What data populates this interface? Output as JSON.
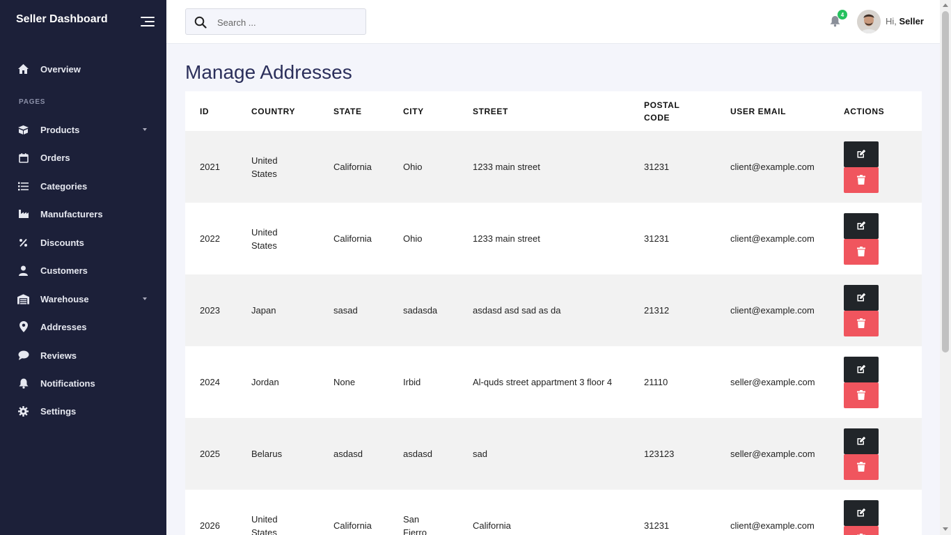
{
  "sidebar": {
    "brand": "Seller Dashboard",
    "section_label": "PAGES",
    "items": [
      {
        "label": "Overview",
        "icon": "home-icon"
      },
      {
        "label": "Products",
        "icon": "box-icon",
        "has_dropdown": true
      },
      {
        "label": "Orders",
        "icon": "calendar-icon"
      },
      {
        "label": "Categories",
        "icon": "list-icon"
      },
      {
        "label": "Manufacturers",
        "icon": "industry-icon"
      },
      {
        "label": "Discounts",
        "icon": "percent-icon"
      },
      {
        "label": "Customers",
        "icon": "user-icon"
      },
      {
        "label": "Warehouse",
        "icon": "warehouse-icon",
        "has_dropdown": true
      },
      {
        "label": "Addresses",
        "icon": "map-pin-icon"
      },
      {
        "label": "Reviews",
        "icon": "comment-icon"
      },
      {
        "label": "Notifications",
        "icon": "bell-icon"
      },
      {
        "label": "Settings",
        "icon": "gear-icon"
      }
    ]
  },
  "topbar": {
    "search_placeholder": "Search ...",
    "notification_count": "4",
    "greeting_prefix": "Hi,",
    "user_name": "Seller"
  },
  "page": {
    "title": "Manage Addresses"
  },
  "table": {
    "headers": [
      "ID",
      "COUNTRY",
      "STATE",
      "CITY",
      "STREET",
      "POSTAL CODE",
      "USER EMAIL",
      "ACTIONS"
    ],
    "rows": [
      {
        "id": "2021",
        "country": "United States",
        "state": "California",
        "city": "Ohio",
        "street": "1233 main street",
        "postal": "31231",
        "email": "client@example.com"
      },
      {
        "id": "2022",
        "country": "United States",
        "state": "California",
        "city": "Ohio",
        "street": "1233 main street",
        "postal": "31231",
        "email": "client@example.com"
      },
      {
        "id": "2023",
        "country": "Japan",
        "state": "sasad",
        "city": "sadasda",
        "street": "asdasd asd sad as da",
        "postal": "21312",
        "email": "client@example.com"
      },
      {
        "id": "2024",
        "country": "Jordan",
        "state": "None",
        "city": "Irbid",
        "street": "Al-quds street appartment 3 floor 4",
        "postal": "21110",
        "email": "seller@example.com"
      },
      {
        "id": "2025",
        "country": "Belarus",
        "state": "asdasd",
        "city": "asdasd",
        "street": "sad",
        "postal": "123123",
        "email": "seller@example.com"
      },
      {
        "id": "2026",
        "country": "United States",
        "state": "California",
        "city": "San Fierro",
        "street": "California",
        "postal": "31231",
        "email": "client@example.com"
      }
    ]
  },
  "colors": {
    "sidebar_bg": "#1c2039",
    "edit_button": "#212529",
    "delete_button": "#f0555e",
    "badge": "#25c15e"
  }
}
